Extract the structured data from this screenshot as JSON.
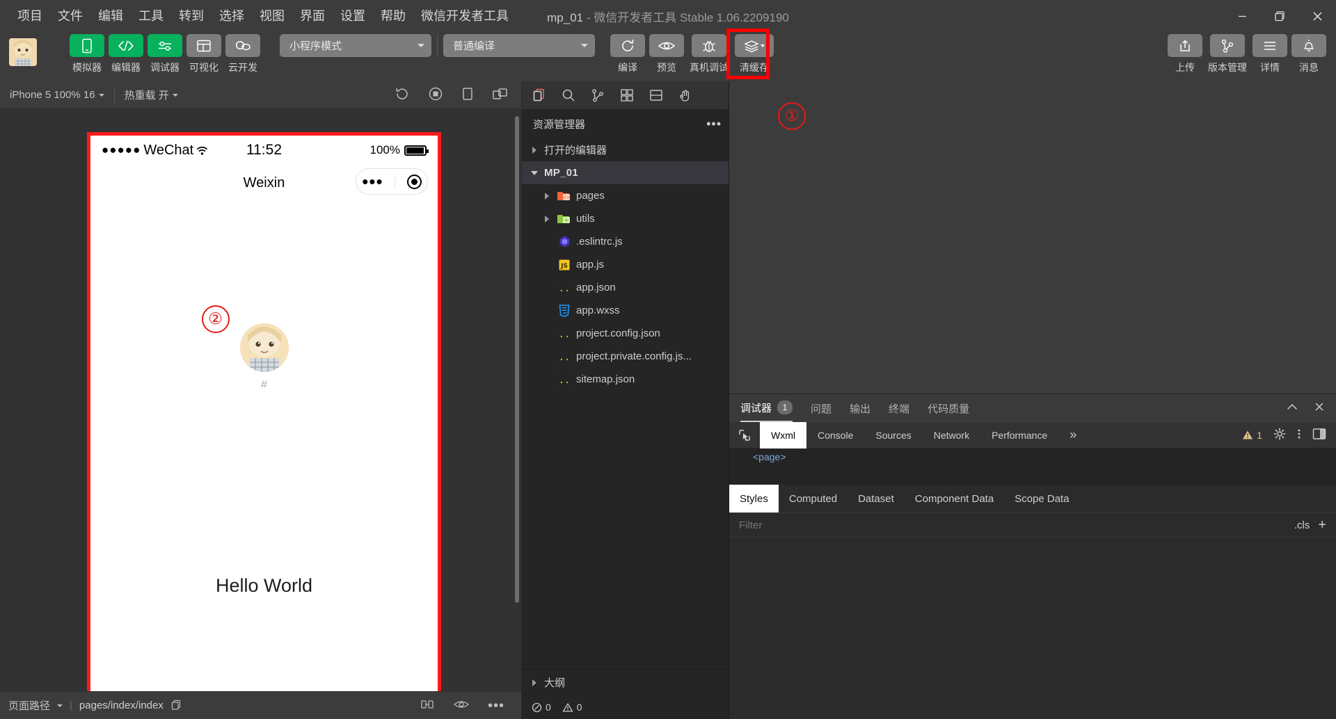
{
  "window": {
    "title_project": "mp_01",
    "title_rest": " - 微信开发者工具 Stable 1.06.2209190",
    "minimize": "minimize-icon",
    "maximize": "maximize-icon",
    "close": "close-icon"
  },
  "menu": {
    "items": [
      {
        "label": "项目"
      },
      {
        "label": "文件"
      },
      {
        "label": "编辑"
      },
      {
        "label": "工具"
      },
      {
        "label": "转到"
      },
      {
        "label": "选择"
      },
      {
        "label": "视图"
      },
      {
        "label": "界面"
      },
      {
        "label": "设置"
      },
      {
        "label": "帮助"
      },
      {
        "label": "微信开发者工具"
      }
    ]
  },
  "toolbar": {
    "left_buttons": [
      {
        "label": "模拟器",
        "icon": "phone-icon",
        "active": true
      },
      {
        "label": "编辑器",
        "icon": "code-icon",
        "active": true
      },
      {
        "label": "调试器",
        "icon": "sliders-icon",
        "active": true
      },
      {
        "label": "可视化",
        "icon": "layout-icon",
        "active": false
      },
      {
        "label": "云开发",
        "icon": "cloud-icon",
        "active": false
      }
    ],
    "mode_select": "小程序模式",
    "compile_select": "普通编译",
    "mid_buttons": [
      {
        "label": "编译",
        "icon": "refresh-icon"
      },
      {
        "label": "预览",
        "icon": "eye-icon"
      },
      {
        "label": "真机调试",
        "icon": "bug-icon"
      },
      {
        "label": "清缓存",
        "icon": "layers-icon"
      }
    ],
    "right_buttons": [
      {
        "label": "上传",
        "icon": "upload-icon"
      },
      {
        "label": "版本管理",
        "icon": "git-branch-icon"
      },
      {
        "label": "详情",
        "icon": "menu-lines-icon"
      },
      {
        "label": "消息",
        "icon": "bell-icon"
      }
    ]
  },
  "annotations": [
    {
      "id": "1",
      "label": "①"
    },
    {
      "id": "2",
      "label": "②"
    }
  ],
  "simulator": {
    "device_select": "iPhone 5 100% 16",
    "hotreload_select": "热重载 开",
    "toolbar_icons": [
      "rotate-icon",
      "stop-record-icon",
      "device-icon",
      "multi-window-icon"
    ],
    "phone": {
      "carrier_dots": "●●●●●",
      "carrier": "WeChat",
      "wifi": "wifi-icon",
      "time": "11:52",
      "battery_pct": "100%",
      "nav_title": "Weixin",
      "capsule_more": "•••",
      "capsule_target": "target-icon",
      "user_hash": "#",
      "hello": "Hello World"
    },
    "footer": {
      "path_label": "页面路径",
      "path_value": "pages/index/index",
      "copy_icon": "copy-icon",
      "icons": [
        "wifi-throttle-icon",
        "eye-icon",
        "more-icon"
      ]
    }
  },
  "explorer": {
    "tabs": [
      "files-icon",
      "search-icon",
      "source-control-icon",
      "extensions-icon",
      "split-icon",
      "hand-icon"
    ],
    "header": "资源管理器",
    "header_more": "•••",
    "sections": [
      {
        "label": "打开的编辑器",
        "expanded": false,
        "bold": false
      },
      {
        "label": "MP_01",
        "expanded": true,
        "bold": true,
        "selected": true
      }
    ],
    "files": [
      {
        "label": "pages",
        "type": "folder-pages",
        "expandable": true,
        "indent": 2
      },
      {
        "label": "utils",
        "type": "folder-utils",
        "expandable": true,
        "indent": 2
      },
      {
        "label": ".eslintrc.js",
        "type": "eslint",
        "expandable": false,
        "indent": 2
      },
      {
        "label": "app.js",
        "type": "js",
        "expandable": false,
        "indent": 2
      },
      {
        "label": "app.json",
        "type": "json",
        "expandable": false,
        "indent": 2
      },
      {
        "label": "app.wxss",
        "type": "wxss",
        "expandable": false,
        "indent": 2
      },
      {
        "label": "project.config.json",
        "type": "json",
        "expandable": false,
        "indent": 2
      },
      {
        "label": "project.private.config.js...",
        "type": "json",
        "expandable": false,
        "indent": 2
      },
      {
        "label": "sitemap.json",
        "type": "json",
        "expandable": false,
        "indent": 2
      }
    ],
    "outline": "大纲",
    "footer": {
      "errors_icon": "error-circle-icon",
      "errors": "0",
      "warnings_icon": "warning-triangle-icon",
      "warnings": "0"
    }
  },
  "panel": {
    "tabs": [
      {
        "label": "调试器",
        "badge": "1",
        "active": true
      },
      {
        "label": "问题",
        "badge": "",
        "active": false
      },
      {
        "label": "输出",
        "badge": "",
        "active": false
      },
      {
        "label": "终端",
        "badge": "",
        "active": false
      },
      {
        "label": "代码质量",
        "badge": "",
        "active": false
      }
    ],
    "collapse_icon": "chevron-up-icon",
    "close_icon": "close-icon",
    "devtools_tabs": [
      {
        "label": "Wxml",
        "active": true
      },
      {
        "label": "Console",
        "active": false
      },
      {
        "label": "Sources",
        "active": false
      },
      {
        "label": "Network",
        "active": false
      },
      {
        "label": "Performance",
        "active": false
      }
    ],
    "overflow": "»",
    "warning_count": "1",
    "warning_icon": "warning-triangle-icon",
    "settings_icon": "gear-icon",
    "more_icon": "kebab-icon",
    "dock_icon": "dock-icon",
    "inspect_icon": "inspect-icon",
    "wxml_snippet": "<page>",
    "style_tabs": [
      {
        "label": "Styles",
        "active": true
      },
      {
        "label": "Computed",
        "active": false
      },
      {
        "label": "Dataset",
        "active": false
      },
      {
        "label": "Component Data",
        "active": false
      },
      {
        "label": "Scope Data",
        "active": false
      }
    ],
    "filter_placeholder": "Filter",
    "cls_label": ".cls",
    "plus_label": "+"
  },
  "colors": {
    "accent_green": "#07b15d",
    "annotation_red": "#ff0000",
    "titlebar_bg": "#3c3c3c",
    "panel_bg": "#2b2b2b",
    "explorer_bg": "#252526"
  }
}
